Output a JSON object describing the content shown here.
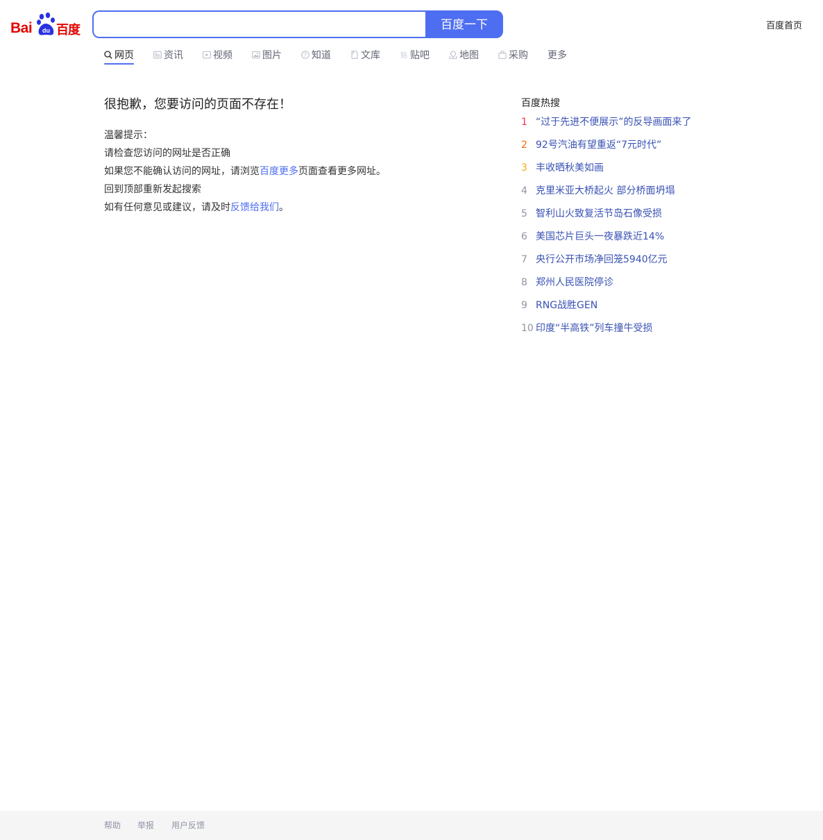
{
  "logo": {
    "text_latin": "Bai",
    "text_paw": "du",
    "text_cn": "百度"
  },
  "search": {
    "value": "",
    "placeholder": "",
    "button_label": "百度一下"
  },
  "header": {
    "home_link": "百度首页"
  },
  "tabs": [
    {
      "label": "网页",
      "icon": "search-icon",
      "active": true
    },
    {
      "label": "资讯",
      "icon": "news-icon"
    },
    {
      "label": "视频",
      "icon": "video-icon"
    },
    {
      "label": "图片",
      "icon": "image-icon"
    },
    {
      "label": "知道",
      "icon": "question-icon"
    },
    {
      "label": "文库",
      "icon": "doc-icon"
    },
    {
      "label": "贴吧",
      "icon": "tieba-icon"
    },
    {
      "label": "地图",
      "icon": "map-icon"
    },
    {
      "label": "采购",
      "icon": "shopping-icon"
    },
    {
      "label": "更多"
    }
  ],
  "error": {
    "title": "很抱歉，您要访问的页面不存在！",
    "tips_heading": "温馨提示：",
    "line1": "请检查您访问的网址是否正确",
    "line2_pre": "如果您不能确认访问的网址，请浏览",
    "line2_link": "百度更多",
    "line2_post": "页面查看更多网址。",
    "line3": "回到顶部重新发起搜索",
    "line4_pre": "如有任何意见或建议，请及时",
    "line4_link": "反馈给我们",
    "line4_post": "。"
  },
  "hot": {
    "title": "百度热搜",
    "rank_colors": [
      "#fe2d46",
      "#f60",
      "#faa90e"
    ],
    "items": [
      {
        "rank": "1",
        "text": "“过于先进不便展示”的反导画面来了"
      },
      {
        "rank": "2",
        "text": "92号汽油有望重返“7元时代”"
      },
      {
        "rank": "3",
        "text": "丰收晒秋美如画"
      },
      {
        "rank": "4",
        "text": "克里米亚大桥起火 部分桥面坍塌"
      },
      {
        "rank": "5",
        "text": "智利山火致复活节岛石像受损"
      },
      {
        "rank": "6",
        "text": "美国芯片巨头一夜暴跌近14%"
      },
      {
        "rank": "7",
        "text": "央行公开市场净回笼5940亿元"
      },
      {
        "rank": "8",
        "text": "郑州人民医院停诊"
      },
      {
        "rank": "9",
        "text": "RNG战胜GEN"
      },
      {
        "rank": "10",
        "text": "印度“半高铁”列车撞牛受损"
      }
    ]
  },
  "footer": {
    "help": "帮助",
    "report": "举报",
    "feedback": "用户反馈"
  }
}
